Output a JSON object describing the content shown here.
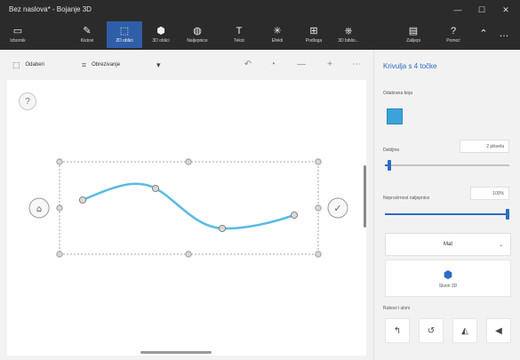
{
  "window": {
    "title": "Bez naslova* - Bojanje 3D",
    "controls": [
      "—",
      "☐",
      "✕"
    ]
  },
  "ribbon": {
    "items": [
      {
        "label": "Izbornik",
        "icon": "folder-icon",
        "glyph": "▭"
      },
      {
        "label": "Kistovi",
        "icon": "brush-icon",
        "glyph": "✎"
      },
      {
        "label": "2D oblici",
        "icon": "shapes-2d-icon",
        "glyph": "⬚"
      },
      {
        "label": "3D oblici",
        "icon": "shapes-3d-icon",
        "glyph": "⬢"
      },
      {
        "label": "Naljepnice",
        "icon": "sticker-icon",
        "glyph": "◍"
      },
      {
        "label": "Tekst",
        "icon": "text-icon",
        "glyph": "T"
      },
      {
        "label": "Efekti",
        "icon": "effects-icon",
        "glyph": "✳"
      },
      {
        "label": "Podloga",
        "icon": "canvas-icon",
        "glyph": "⊞"
      },
      {
        "label": "3D biblio...",
        "icon": "library-icon",
        "glyph": "⎈"
      },
      {
        "label": "Zalijepi",
        "icon": "paste-icon",
        "glyph": "▤"
      },
      {
        "label": "Pomoć",
        "icon": "help-icon",
        "glyph": "?"
      }
    ],
    "active_index": 2,
    "more_glyph": "⌃",
    "overflow_glyph": "…"
  },
  "toolbar": {
    "select_label": "Odaberi",
    "crop_label": "Obrezivanje",
    "magic_icon": "▾",
    "undo_glyph": "↶",
    "history_glyph": "◔",
    "zoom_out_glyph": "—",
    "zoom_in_glyph": "+",
    "more_glyph": "⋯"
  },
  "canvas": {
    "help_glyph": "?",
    "left_handle_glyph": "⌂",
    "confirm_glyph": "✓",
    "curve_color": "#5bbbe4"
  },
  "panel": {
    "title": "Krivulja s 4 točke",
    "fill_label": "Odabrana boja",
    "fill_color": "#3aa3dc",
    "thickness_label": "Debljina",
    "thickness_value": "2 piksela",
    "thickness_level": 0.02,
    "opacity_label": "Neprozirnost naljepnice",
    "opacity_value": "100%",
    "opacity_level": 1.0,
    "material_value": "Mat",
    "make3d_label": "Stvori 3D",
    "edges_label": "Rubovi i uloni",
    "edge_glyphs": [
      "↰",
      "↺",
      "◭",
      "◀"
    ]
  }
}
